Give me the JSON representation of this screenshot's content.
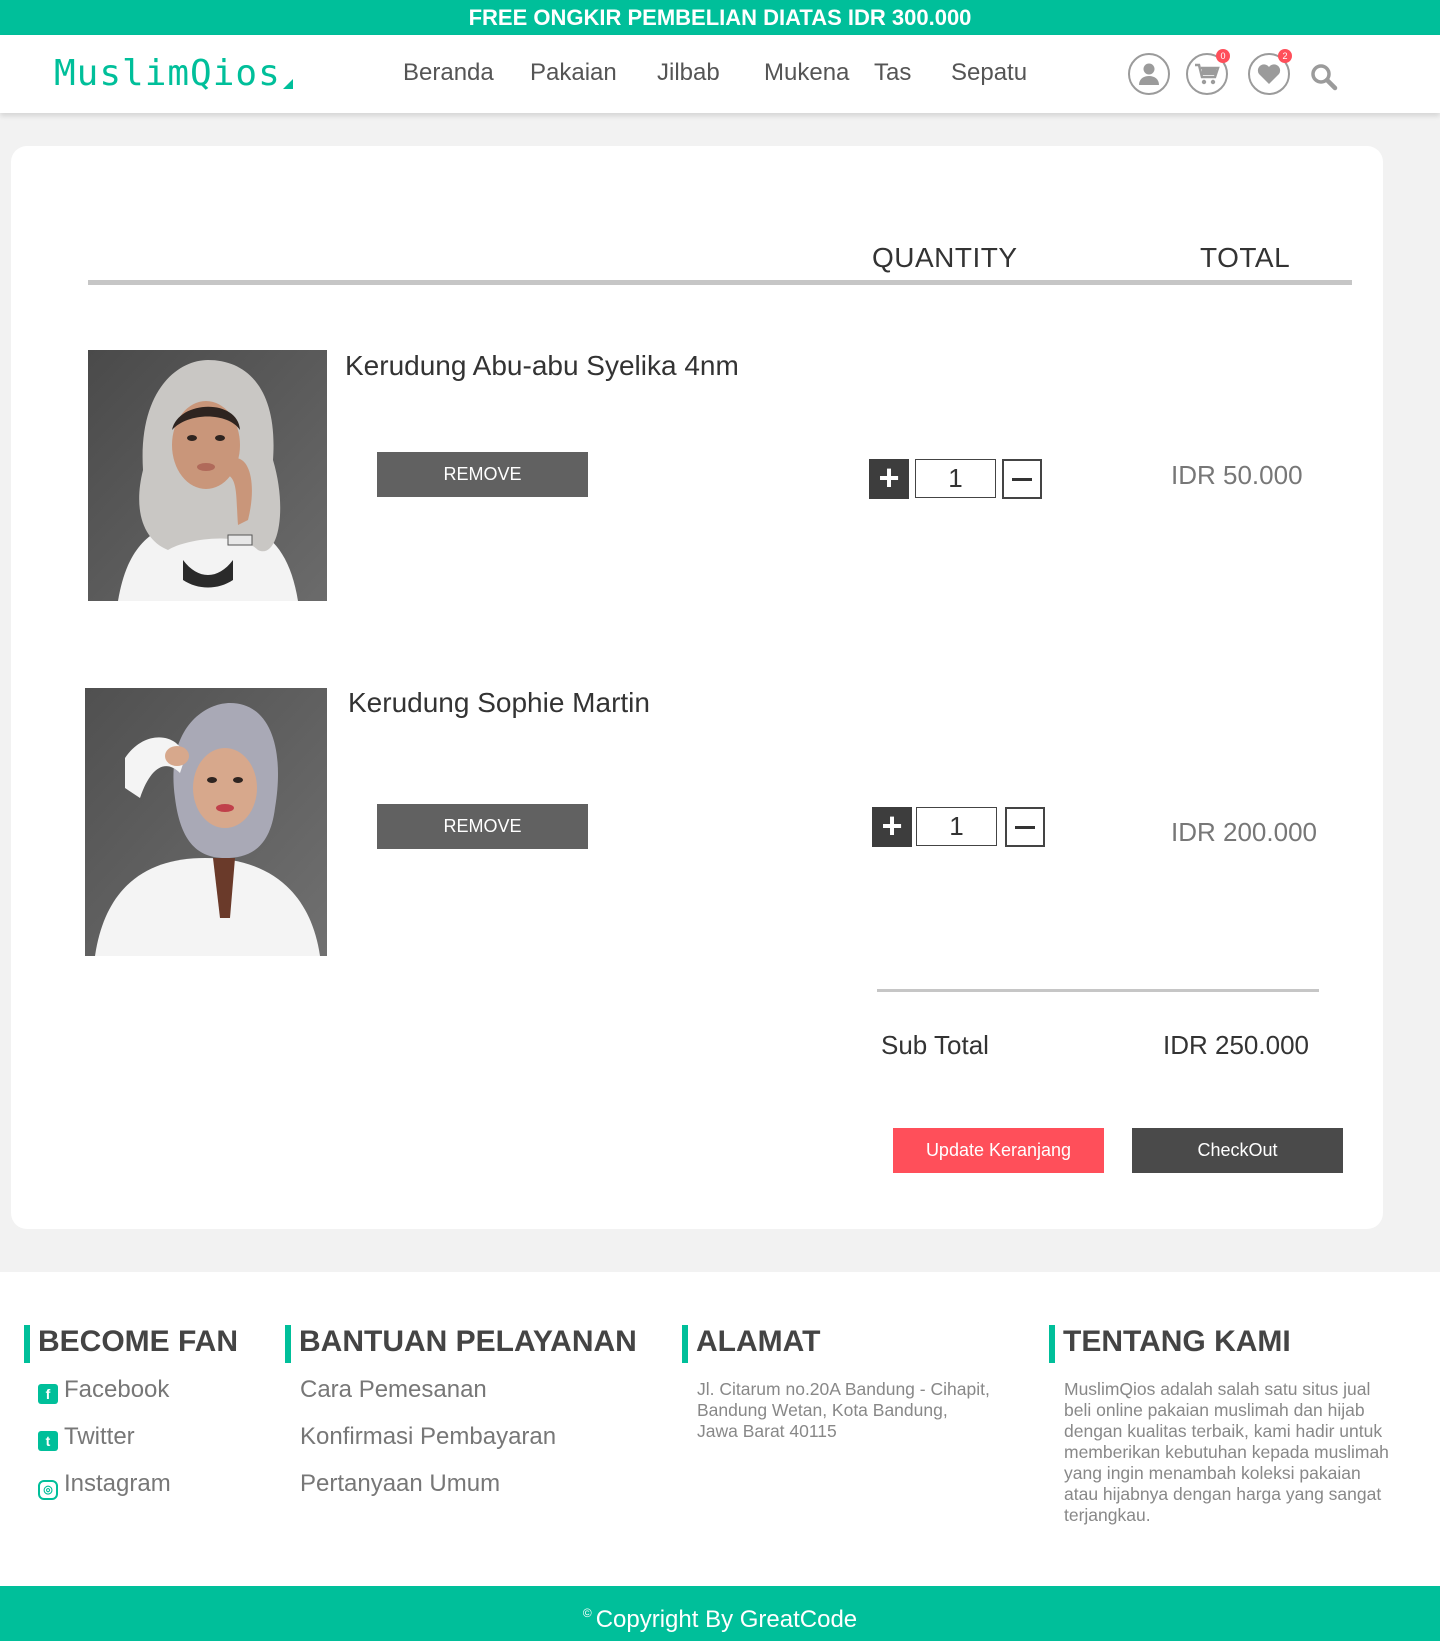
{
  "promo": "FREE ONGKIR PEMBELIAN DIATAS IDR 300.000",
  "brand": "MuslimQios",
  "nav": [
    "Beranda",
    "Pakaian",
    "Jilbab",
    "Mukena",
    "Tas",
    "Sepatu"
  ],
  "header_icons": {
    "user": "user-icon",
    "cart": "cart-icon",
    "wishlist": "heart-icon",
    "search": "search-icon",
    "cart_count": "0",
    "wishlist_count": "2"
  },
  "cart": {
    "col_quantity": "QUANTITY",
    "col_total": "TOTAL",
    "items": [
      {
        "name": "Kerudung Abu-abu Syelika 4nm",
        "remove": "REMOVE",
        "qty": "1",
        "price": "IDR 50.000"
      },
      {
        "name": "Kerudung Sophie Martin",
        "remove": "REMOVE",
        "qty": "1",
        "price": "IDR 200.000"
      }
    ],
    "subtotal_label": "Sub Total",
    "subtotal_value": "IDR 250.000",
    "update_button": "Update Keranjang",
    "checkout_button": "CheckOut"
  },
  "footer": {
    "fan": {
      "title": "BECOME FAN",
      "links": [
        "Facebook",
        "Twitter",
        "Instagram"
      ]
    },
    "help": {
      "title": "BANTUAN PELAYANAN",
      "links": [
        "Cara Pemesanan",
        "Konfirmasi Pembayaran",
        "Pertanyaan Umum"
      ]
    },
    "address": {
      "title": "ALAMAT",
      "lines": [
        "Jl. Citarum no.20A Bandung - Cihapit,",
        "Bandung Wetan, Kota Bandung,",
        "Jawa Barat 40115"
      ]
    },
    "about": {
      "title": "TENTANG KAMI",
      "lines": [
        "MuslimQios adalah salah satu situs jual",
        "beli online pakaian muslimah dan hijab",
        "dengan kualitas terbaik, kami hadir untuk",
        "memberikan kebutuhan kepada muslimah",
        "yang ingin menambah koleksi pakaian",
        "atau hijabnya dengan harga yang sangat",
        "terjangkau."
      ]
    },
    "copyright": "Copyright By GreatCode"
  },
  "colors": {
    "accent": "#00bf9a",
    "danger": "#ff4f5a",
    "dark_button": "#4a4a4a"
  }
}
